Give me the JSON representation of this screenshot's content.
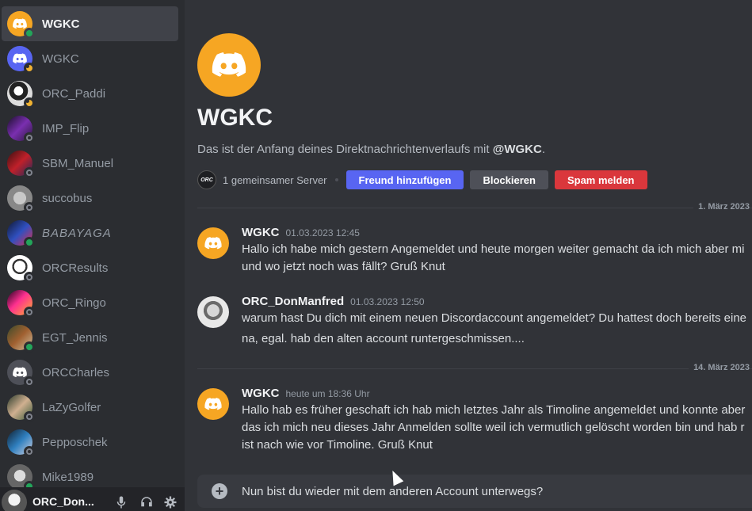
{
  "sidebar": {
    "dms": [
      {
        "name": "WGKC",
        "status": "online",
        "avatar": "discord-orange",
        "active": true
      },
      {
        "name": "WGKC",
        "status": "idle",
        "avatar": "discord-blurple",
        "active": false
      },
      {
        "name": "ORC_Paddi",
        "status": "idle",
        "avatar": "photo",
        "active": false
      },
      {
        "name": "IMP_Flip",
        "status": "offline",
        "avatar": "photo",
        "active": false
      },
      {
        "name": "SBM_Manuel",
        "status": "offline",
        "avatar": "photo",
        "active": false
      },
      {
        "name": "succobus",
        "status": "offline",
        "avatar": "photo",
        "active": false
      },
      {
        "name": "BABAYAGA",
        "status": "online",
        "avatar": "photo",
        "active": false
      },
      {
        "name": "ORCResults",
        "status": "offline",
        "avatar": "photo",
        "active": false
      },
      {
        "name": "ORC_Ringo",
        "status": "offline",
        "avatar": "photo",
        "active": false
      },
      {
        "name": "EGT_Jennis",
        "status": "online",
        "avatar": "photo",
        "active": false
      },
      {
        "name": "ORCCharles",
        "status": "offline",
        "avatar": "discord-grey",
        "active": false
      },
      {
        "name": "LaZyGolfer",
        "status": "offline",
        "avatar": "photo",
        "active": false
      },
      {
        "name": "Pepposchek",
        "status": "offline",
        "avatar": "photo",
        "active": false
      },
      {
        "name": "Mike1989",
        "status": "online",
        "avatar": "photo",
        "active": false
      }
    ]
  },
  "user_panel": {
    "name": "ORC_Don..."
  },
  "channel": {
    "title": "WGKC",
    "intro_prefix": "Das ist der Anfang deines Direktnachrichtenverlaufs mit ",
    "intro_mention": "@WGKC",
    "intro_suffix": ".",
    "mutual_server_badge": "ORC",
    "mutual_servers": "1 gemeinsamer Server",
    "add_friend": "Freund hinzufügen",
    "block": "Blockieren",
    "report_spam": "Spam melden"
  },
  "dividers": [
    "1. März 2023",
    "14. März 2023"
  ],
  "messages": [
    {
      "author": "WGKC",
      "time": "01.03.2023 12:45",
      "avatar": "discord-orange",
      "lines": [
        "Hallo ich habe mich gestern Angemeldet und heute morgen weiter gemacht da ich mich aber mi",
        "und wo jetzt noch was fällt? Gruß Knut"
      ]
    },
    {
      "author": "ORC_DonManfred",
      "time": "01.03.2023 12:50",
      "avatar": "photo",
      "lines": [
        "warum hast Du dich mit einem neuen Discordaccount angemeldet? Du hattest doch bereits eine",
        "na, egal. hab den alten account runtergeschmissen...."
      ]
    },
    {
      "author": "WGKC",
      "time": "heute um 18:36 Uhr",
      "avatar": "discord-orange",
      "lines": [
        "Hallo hab es früher geschaft ich hab mich letztes Jahr als Timoline angemeldet und konnte aber",
        "das ich mich neu dieses Jahr Anmelden sollte weil ich vermutlich gelöscht worden bin und hab r",
        "ist nach wie vor Timoline. Gruß Knut"
      ]
    }
  ],
  "composer": {
    "text": "Nun bist du wieder mit dem anderen Account unterwegs?"
  },
  "colors": {
    "accent": "#5865f2",
    "danger": "#da373c",
    "online": "#23a55a",
    "idle": "#f0b232",
    "offline": "#80848e",
    "discord_orange": "#f6a623"
  }
}
